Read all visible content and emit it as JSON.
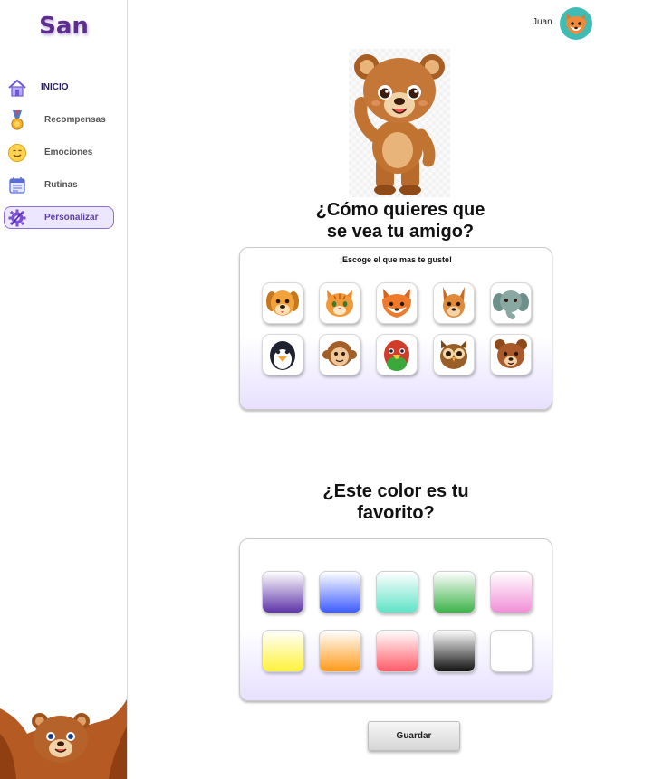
{
  "sidebar": {
    "logo": "San",
    "items": [
      {
        "label": "INICIO",
        "icon": "house-icon"
      },
      {
        "label": "Recompensas",
        "icon": "medal-icon"
      },
      {
        "label": "Emociones",
        "icon": "smiley-icon"
      },
      {
        "label": "Rutinas",
        "icon": "calendar-icon"
      },
      {
        "label": "Personalizar",
        "icon": "gear-icon"
      }
    ],
    "active_item": "Personalizar",
    "bottom_mascot": "bear-mascot-icon"
  },
  "header": {
    "user_name": "Juan",
    "avatar_icon": "fox-avatar-icon"
  },
  "friend_section": {
    "title_line1": "¿Cómo quieres que",
    "title_line2": "se vea tu amigo?",
    "subtitle": "¡Escoge el que mas te guste!",
    "animals": [
      "dog",
      "cat",
      "fox",
      "kangaroo",
      "elephant",
      "penguin",
      "monkey",
      "parrot",
      "owl",
      "bear"
    ]
  },
  "color_section": {
    "title_line1": "¿Este color es tu",
    "title_line2": "favorito?",
    "colors": [
      {
        "name": "purple",
        "hex": "#5e35a8"
      },
      {
        "name": "blue",
        "hex": "#3d5cff"
      },
      {
        "name": "aqua",
        "hex": "#5fe3c6"
      },
      {
        "name": "green",
        "hex": "#3db34a"
      },
      {
        "name": "pink",
        "hex": "#f08fd6"
      },
      {
        "name": "yellow",
        "hex": "#fff23a"
      },
      {
        "name": "orange",
        "hex": "#ff9a1a"
      },
      {
        "name": "red",
        "hex": "#ff5a66"
      },
      {
        "name": "black",
        "hex": "#111111"
      },
      {
        "name": "white",
        "hex": "#ffffff"
      }
    ]
  },
  "actions": {
    "save_label": "Guardar"
  },
  "theme": {
    "brand_purple": "#5b2d91",
    "active_bg": "#ece6ff",
    "card_gradient_end": "#e7e0ff"
  }
}
